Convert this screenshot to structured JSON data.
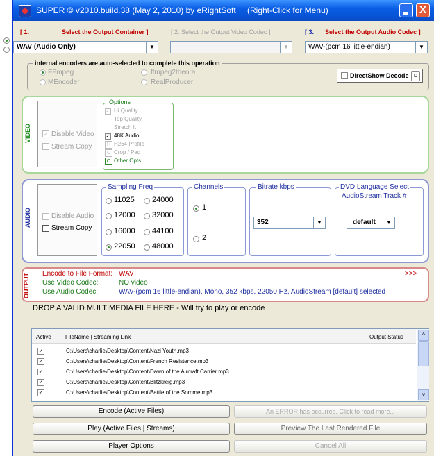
{
  "window": {
    "title": "SUPER © v2010.build.38 (May 2, 2010) by eRightSoft",
    "hint": "(Right-Click for Menu)",
    "close_glyph": "X"
  },
  "containers": {
    "h1_num": "[ 1.",
    "h1_label": "Select the Output Container ]",
    "h2_label": "[ 2.   Select the Output Video Codec ]",
    "h3_num": "[ 3.",
    "h3_label": "Select the Output Audio Codec ]",
    "container_value": "WAV   (Audio Only)",
    "video_codec_value": "",
    "audio_codec_value": "WAV-(pcm 16 little-endian)"
  },
  "encoders": {
    "label": "internal encoders are auto-selected to complete this operation",
    "items": [
      "FFmpeg",
      "ffmpeg2theora",
      "MEncoder",
      "RealProducer"
    ],
    "directshow_label": "DirectShow Decode",
    "directshow_badge": "D"
  },
  "video": {
    "section_label": "VIDEO",
    "disable_video": "Disable Video",
    "stream_copy": "Stream Copy",
    "options_title": "Options",
    "options": [
      "Hi Quality",
      "Top Quality",
      "Stretch It",
      "48K Audio",
      "H264 Profile",
      "Crop / Pad",
      "Other Opts"
    ],
    "option_prefixes": [
      "",
      "",
      "",
      "",
      "H",
      "C",
      "O"
    ]
  },
  "audio": {
    "section_label": "AUDIO",
    "disable_audio": "Disable Audio",
    "stream_copy": "Stream Copy",
    "sampling_title": "Sampling Freq",
    "freqs": [
      "11025",
      "24000",
      "12000",
      "32000",
      "16000",
      "44100",
      "22050",
      "48000"
    ],
    "selected_freq": "22050",
    "channels_title": "Channels",
    "channels": [
      "1",
      "2"
    ],
    "selected_channel": "1",
    "bitrate_title": "Bitrate  kbps",
    "bitrate_value": "352",
    "dvd_title": "DVD Language Select",
    "dvd_sub": "AudioStream  Track #",
    "dvd_value": "default"
  },
  "output": {
    "section_label": "OUTPUT",
    "line1_label": "Encode to File Format:",
    "line1_value": "WAV",
    "line2_label": "Use Video Codec:",
    "line2_value": "NO video",
    "line3_label": "Use Audio Codec:",
    "line3_value": "WAV-(pcm 16 little-endian), Mono, 352 kbps, 22050 Hz, AudioStream [default] selected",
    "more": ">>>"
  },
  "drop_text": "DROP A VALID MULTIMEDIA FILE HERE - Will try to play or encode",
  "files": {
    "col_active": "Active",
    "col_name": "FileName  |  Streaming Link",
    "col_status": "Output Status",
    "rows": [
      "C:\\Users\\charlie\\Desktop\\Content\\Nazi Youth.mp3",
      "C:\\Users\\charlie\\Desktop\\Content\\French Resistence.mp3",
      "C:\\Users\\charlie\\Desktop\\Content\\Dawn of the Aircraft Carrier.mp3",
      "C:\\Users\\charlie\\Desktop\\Content\\Blitzkreig.mp3",
      "C:\\Users\\charlie\\Desktop\\Content\\Battle of the Somme.mp3"
    ]
  },
  "buttons": {
    "encode": "Encode (Active Files)",
    "error": "An ERROR has occurred. Click to read more...",
    "play": "Play (Active Files | Streams)",
    "preview": "Preview The Last Rendered File",
    "player_options": "Player Options",
    "cancel_all": "Cancel All"
  }
}
